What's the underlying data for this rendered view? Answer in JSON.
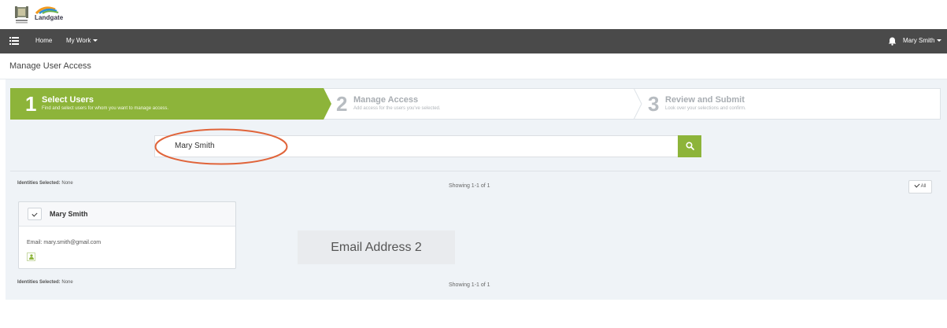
{
  "brand": {
    "logo_text": "Landgate"
  },
  "nav": {
    "home": "Home",
    "my_work": "My Work",
    "user": "Mary Smith"
  },
  "page": {
    "title": "Manage User Access"
  },
  "wizard": {
    "steps": [
      {
        "number": "1",
        "title": "Select Users",
        "desc": "Find and select users for whom you want to manage access."
      },
      {
        "number": "2",
        "title": "Manage Access",
        "desc": "Add access for the users you've selected."
      },
      {
        "number": "3",
        "title": "Review and Submit",
        "desc": "Look over your selections and confirm."
      }
    ]
  },
  "search": {
    "value": "Mary Smith"
  },
  "results": {
    "selected_label": "Identities Selected:",
    "selected_value": "None",
    "showing": "Showing 1-1 of 1",
    "all_button": "All"
  },
  "card": {
    "name": "Mary Smith",
    "email_label": "Email:",
    "email": "mary.smith@gmail.com"
  },
  "annotation": {
    "text": "Email Address 2"
  },
  "colors": {
    "accent": "#8db43a",
    "navbar": "#4a4a4a",
    "annotation_ring": "#e0643a"
  }
}
